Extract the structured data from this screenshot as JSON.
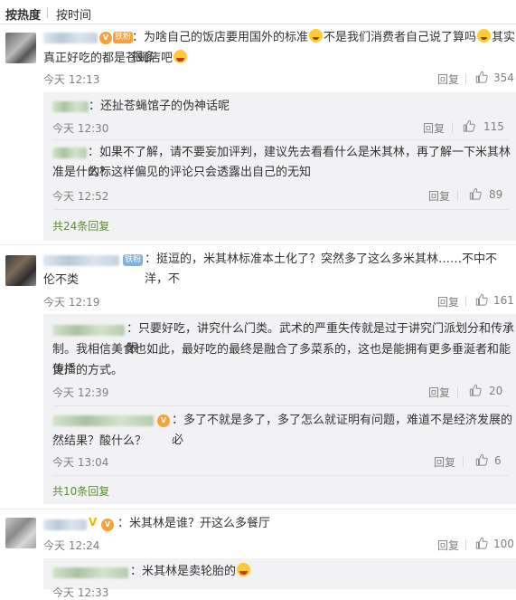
{
  "tabs": {
    "hot": "按热度",
    "time": "按时间"
  },
  "comments": [
    {
      "badge": "铁粉",
      "text1": "：为啥自己的饭店要用国外的标准",
      "text2": "不是我们消费者自己说了算吗",
      "text3": "其实很多",
      "text4": "真正好吃的都是苍蝇店吧",
      "time": "今天 12:13",
      "reply": "回复",
      "likes": "354",
      "replies": [
        {
          "text": "：还扯苍蝇馆子的伪神话呢",
          "time": "今天 12:30",
          "reply": "回复",
          "likes": "115"
        },
        {
          "line1": "：如果不了解，请不要妄加评判，建议先去看看什么是米其林，再了解一下米其林的标",
          "line2": "准是什么？这样偏见的评论只会透露出自己的无知",
          "time": "今天 12:52",
          "reply": "回复",
          "likes": "89"
        }
      ],
      "more": "共24条回复"
    },
    {
      "badge": "铁粉",
      "line1": "：挺逗的，米其林标准本土化了？突然多了这么多米其林……不中不洋，不",
      "line2": "伦不类",
      "time": "今天 12:19",
      "reply": "回复",
      "likes": "161",
      "replies": [
        {
          "line1": "：只要好吃，讲究什么门类。武术的严重失传就是过于讲究门派划分和传承限",
          "line2": "制。我相信美食也如此，最好吃的最终是融合了多菜系的，这也是能拥有更多垂涎者和能传播",
          "line3": "更广的方式。",
          "time": "今天 12:39",
          "reply": "回复",
          "likes": "20"
        },
        {
          "line1": "：多了不就是多了，多了怎么就证明有问题，难道不是经济发展的必",
          "line2": "然结果？酸什么？",
          "time": "今天 13:04",
          "reply": "回复",
          "likes": "6"
        }
      ],
      "more": "共10条回复"
    },
    {
      "text": "：米其林是谁？开这么多餐厅",
      "time": "今天 12:24",
      "reply": "回复",
      "likes": "100",
      "replies": [
        {
          "text": "：米其林是卖轮胎的",
          "time": "今天 12:33"
        }
      ]
    }
  ],
  "colors": {
    "link_green": "#5d8e2e",
    "badge_orange": "#f7a13a",
    "badge_blue": "#7fb1e3",
    "reply_bg": "#f2f2f5"
  },
  "icons": [
    "thumbs-up-icon",
    "vip-icon",
    "verified-v-icon",
    "emoji-icon"
  ]
}
